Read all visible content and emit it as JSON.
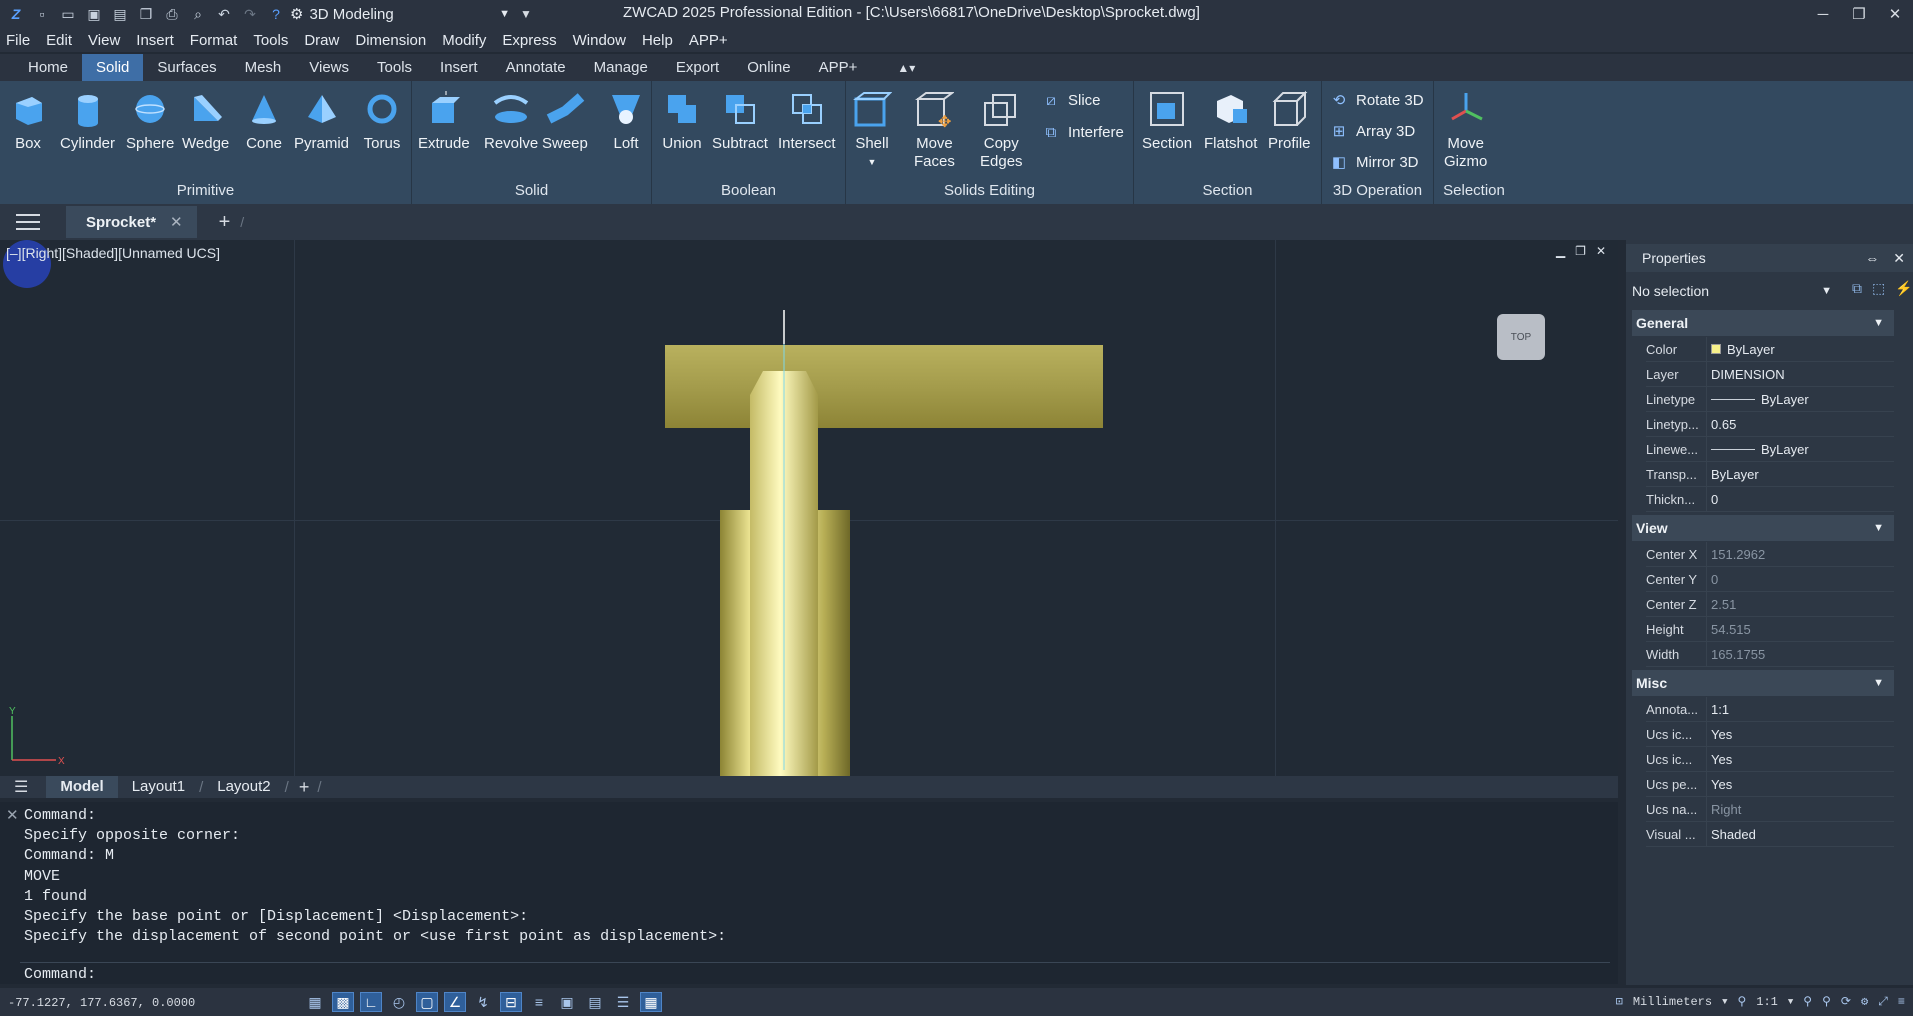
{
  "title": "ZWCAD 2025 Professional Edition - [C:\\Users\\66817\\OneDrive\\Desktop\\Sprocket.dwg]",
  "workspace": "3D Modeling",
  "menu": [
    "File",
    "Edit",
    "View",
    "Insert",
    "Format",
    "Tools",
    "Draw",
    "Dimension",
    "Modify",
    "Express",
    "Window",
    "Help",
    "APP+"
  ],
  "ribbon_tabs": [
    "Home",
    "Solid",
    "Surfaces",
    "Mesh",
    "Views",
    "Tools",
    "Insert",
    "Annotate",
    "Manage",
    "Export",
    "Online",
    "APP+"
  ],
  "ribbon": {
    "primitive": {
      "title": "Primitive",
      "tools": [
        "Box",
        "Cylinder",
        "Sphere",
        "Wedge",
        "Cone",
        "Pyramid",
        "Torus"
      ]
    },
    "solid": {
      "title": "Solid",
      "tools": [
        "Extrude",
        "Revolve",
        "Sweep",
        "Loft"
      ]
    },
    "boolean": {
      "title": "Boolean",
      "tools": [
        "Union",
        "Subtract",
        "Intersect"
      ]
    },
    "solids_editing": {
      "title": "Solids Editing",
      "shell": "Shell",
      "move_faces": "Move\nFaces",
      "copy_edges": "Copy\nEdges",
      "slice": "Slice",
      "interfere": "Interfere"
    },
    "section": {
      "title": "Section",
      "tools": [
        "Section",
        "Flatshot",
        "Profile"
      ]
    },
    "op3d": {
      "title": "3D Operation",
      "rotate": "Rotate 3D",
      "array": "Array 3D",
      "mirror": "Mirror 3D"
    },
    "selection": {
      "title": "Selection",
      "move_gizmo": "Move\nGizmo"
    }
  },
  "doc_tab": "Sprocket*",
  "viewport": {
    "label": "[–][Right][Shaded][Unnamed UCS]",
    "viewcube": "TOP",
    "axis_x": "X",
    "axis_y": "Y"
  },
  "layout_tabs": [
    "Model",
    "Layout1",
    "Layout2"
  ],
  "properties": {
    "title": "Properties",
    "selection": "No selection",
    "general": {
      "title": "General",
      "rows": [
        {
          "k": "Color",
          "v": "ByLayer"
        },
        {
          "k": "Layer",
          "v": "DIMENSION"
        },
        {
          "k": "Linetype",
          "v": "ByLayer"
        },
        {
          "k": "Linetyp...",
          "v": "0.65"
        },
        {
          "k": "Linewe...",
          "v": "ByLayer"
        },
        {
          "k": "Transp...",
          "v": "ByLayer"
        },
        {
          "k": "Thickn...",
          "v": "0"
        }
      ]
    },
    "view": {
      "title": "View",
      "rows": [
        {
          "k": "Center X",
          "v": "151.2962"
        },
        {
          "k": "Center Y",
          "v": "0"
        },
        {
          "k": "Center Z",
          "v": "2.51"
        },
        {
          "k": "Height",
          "v": "54.515"
        },
        {
          "k": "Width",
          "v": "165.1755"
        }
      ]
    },
    "misc": {
      "title": "Misc",
      "rows": [
        {
          "k": "Annota...",
          "v": "1:1"
        },
        {
          "k": "Ucs ic...",
          "v": "Yes"
        },
        {
          "k": "Ucs ic...",
          "v": "Yes"
        },
        {
          "k": "Ucs pe...",
          "v": "Yes"
        },
        {
          "k": "Ucs na...",
          "v": "Right"
        },
        {
          "k": "Visual ...",
          "v": "Shaded"
        }
      ]
    }
  },
  "command_history": "Command:\nSpecify opposite corner:\nCommand: M\nMOVE\n1 found\nSpecify the base point or [Displacement] <Displacement>:\nSpecify the displacement of second point or <use first point as displacement>:",
  "command_prompt": "Command:",
  "status": {
    "coords": "-77.1227, 177.6367, 0.0000",
    "units": "Millimeters",
    "scale": "1:1"
  }
}
